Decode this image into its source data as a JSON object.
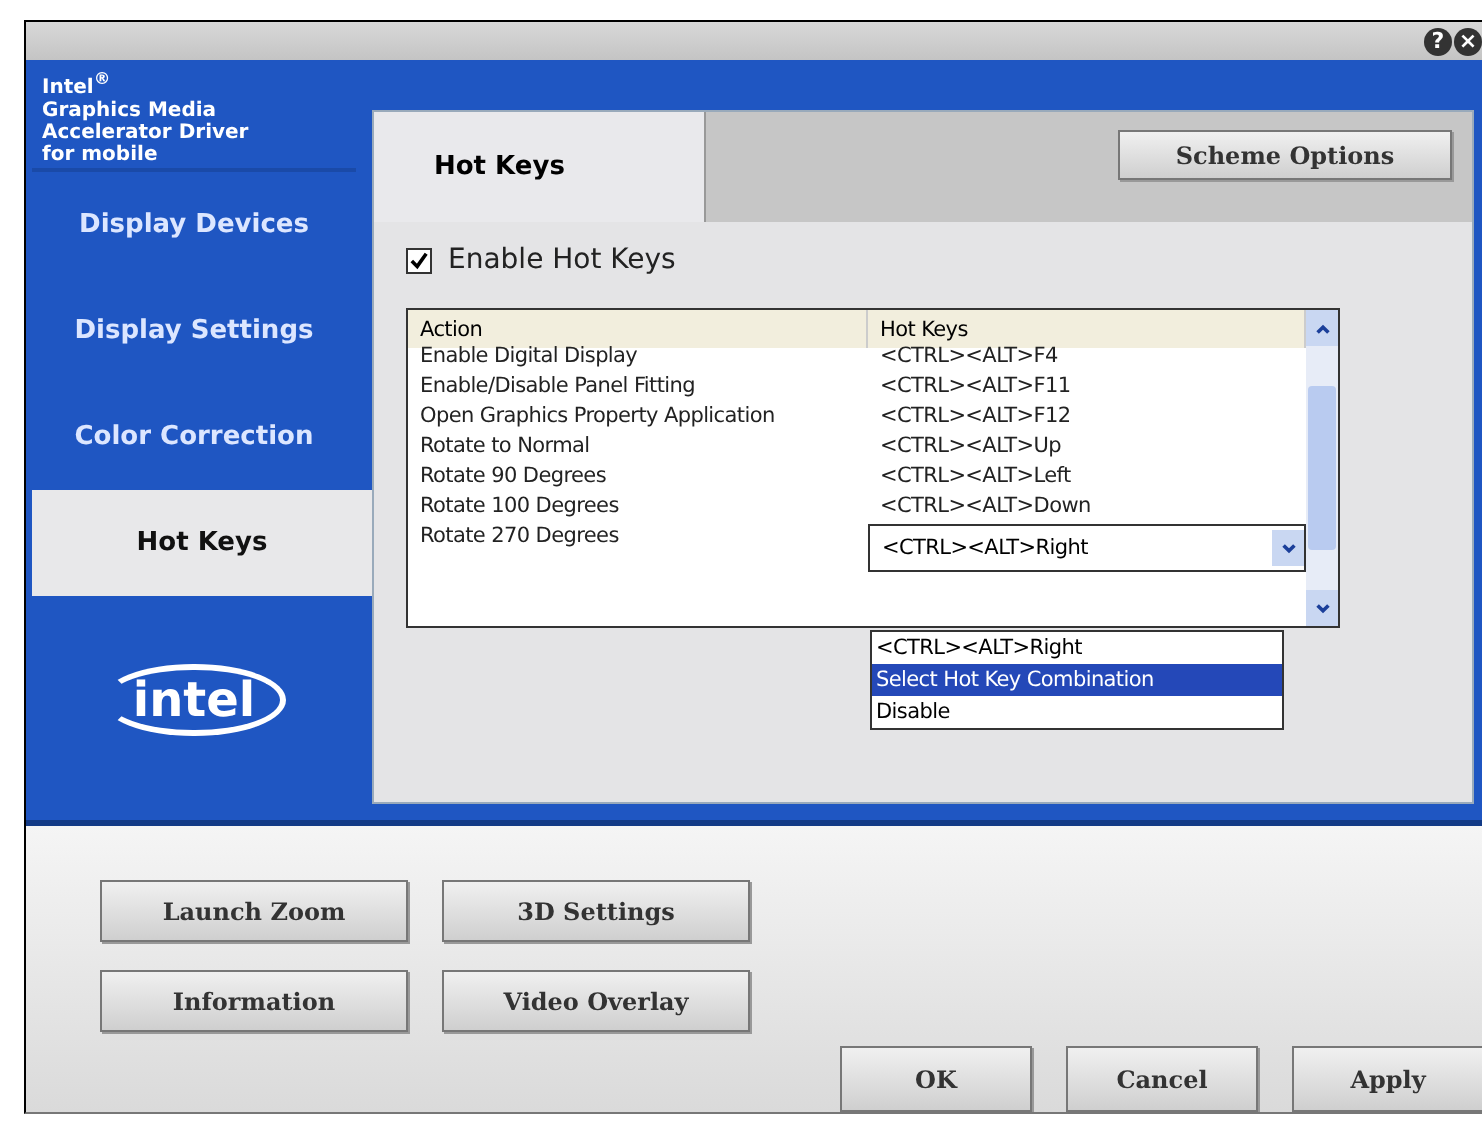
{
  "brand": {
    "title": "Intel$^{®}$\nGraphics Media\nAccelerator Driver\nfor mobile",
    "logo": "intel"
  },
  "title_bar": {
    "help": "?",
    "close": "×"
  },
  "sidebar": {
    "items": [
      {
        "label": "Display Devices",
        "selected": false
      },
      {
        "label": "Display Settings",
        "selected": false
      },
      {
        "label": "Color Correction",
        "selected": false
      },
      {
        "label": "Hot Keys",
        "selected": true
      }
    ]
  },
  "tab": {
    "label": "Hot Keys"
  },
  "scheme_button": "Scheme Options",
  "enable_hot_keys": {
    "label": "Enable Hot Keys",
    "checked": true
  },
  "table": {
    "columns": [
      "Action",
      "Hot Keys"
    ],
    "rows": [
      {
        "action": "Enable Digital Display",
        "keys": "<CTRL><ALT>F4",
        "editing": false
      },
      {
        "action": "Enable/Disable Panel Fitting",
        "keys": "<CTRL><ALT>F11",
        "editing": false
      },
      {
        "action": "Open Graphics Property Application",
        "keys": "<CTRL><ALT>F12",
        "editing": false
      },
      {
        "action": "Rotate to Normal",
        "keys": "<CTRL><ALT>Up",
        "editing": false
      },
      {
        "action": "Rotate 90 Degrees",
        "keys": "<CTRL><ALT>Left",
        "editing": false
      },
      {
        "action": "Rotate 100 Degrees",
        "keys": "<CTRL><ALT>Down",
        "editing": false
      },
      {
        "action": "Rotate 270 Degrees",
        "keys": "<CTRL><ALT>Right",
        "editing": true
      }
    ]
  },
  "dropdown": {
    "options": [
      {
        "label": "<CTRL><ALT>Right",
        "selected": false
      },
      {
        "label": "Select Hot Key Combination",
        "selected": true
      },
      {
        "label": "Disable",
        "selected": false
      }
    ]
  },
  "bottom_buttons": [
    [
      "Launch Zoom",
      "3D Settings"
    ],
    [
      "Information",
      "Video Overlay"
    ]
  ],
  "dialog_buttons": [
    "OK",
    "Cancel",
    "Apply"
  ]
}
